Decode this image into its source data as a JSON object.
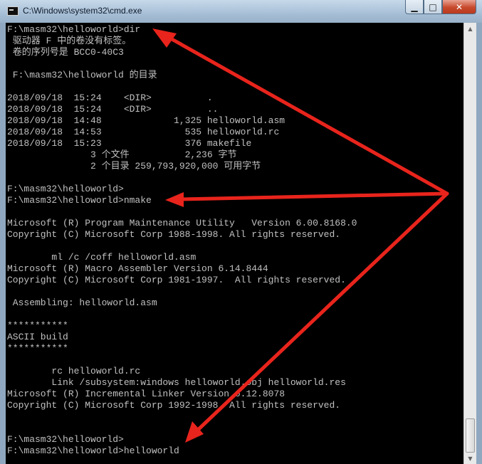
{
  "window": {
    "title": "C:\\Windows\\system32\\cmd.exe",
    "minimize_glyph": "▁",
    "maximize_glyph": "□",
    "close_glyph": "✕"
  },
  "console": {
    "lines": [
      "F:\\masm32\\helloworld>dir",
      " 驱动器 F 中的卷没有标签。",
      " 卷的序列号是 BCC0-40C3",
      "",
      " F:\\masm32\\helloworld 的目录",
      "",
      "2018/09/18  15:24    <DIR>          .",
      "2018/09/18  15:24    <DIR>          ..",
      "2018/09/18  14:48             1,325 helloworld.asm",
      "2018/09/18  14:53               535 helloworld.rc",
      "2018/09/18  15:23               376 makefile",
      "               3 个文件          2,236 字节",
      "               2 个目录 259,793,920,000 可用字节",
      "",
      "F:\\masm32\\helloworld>",
      "F:\\masm32\\helloworld>nmake",
      "",
      "Microsoft (R) Program Maintenance Utility   Version 6.00.8168.0",
      "Copyright (C) Microsoft Corp 1988-1998. All rights reserved.",
      "",
      "        ml /c /coff helloworld.asm",
      "Microsoft (R) Macro Assembler Version 6.14.8444",
      "Copyright (C) Microsoft Corp 1981-1997.  All rights reserved.",
      "",
      " Assembling: helloworld.asm",
      "",
      "***********",
      "ASCII build",
      "***********",
      "",
      "        rc helloworld.rc",
      "        Link /subsystem:windows helloworld.obj helloworld.res",
      "Microsoft (R) Incremental Linker Version 6.12.8078",
      "Copyright (C) Microsoft Corp 1992-1998. All rights reserved.",
      "",
      "",
      "F:\\masm32\\helloworld>",
      "F:\\masm32\\helloworld>helloworld"
    ]
  },
  "scrollbar": {
    "up_glyph": "▲",
    "down_glyph": "▼"
  },
  "colors": {
    "annotation_arrow": "#e8241c",
    "console_text": "#c0c0c0",
    "console_bg": "#000000"
  }
}
